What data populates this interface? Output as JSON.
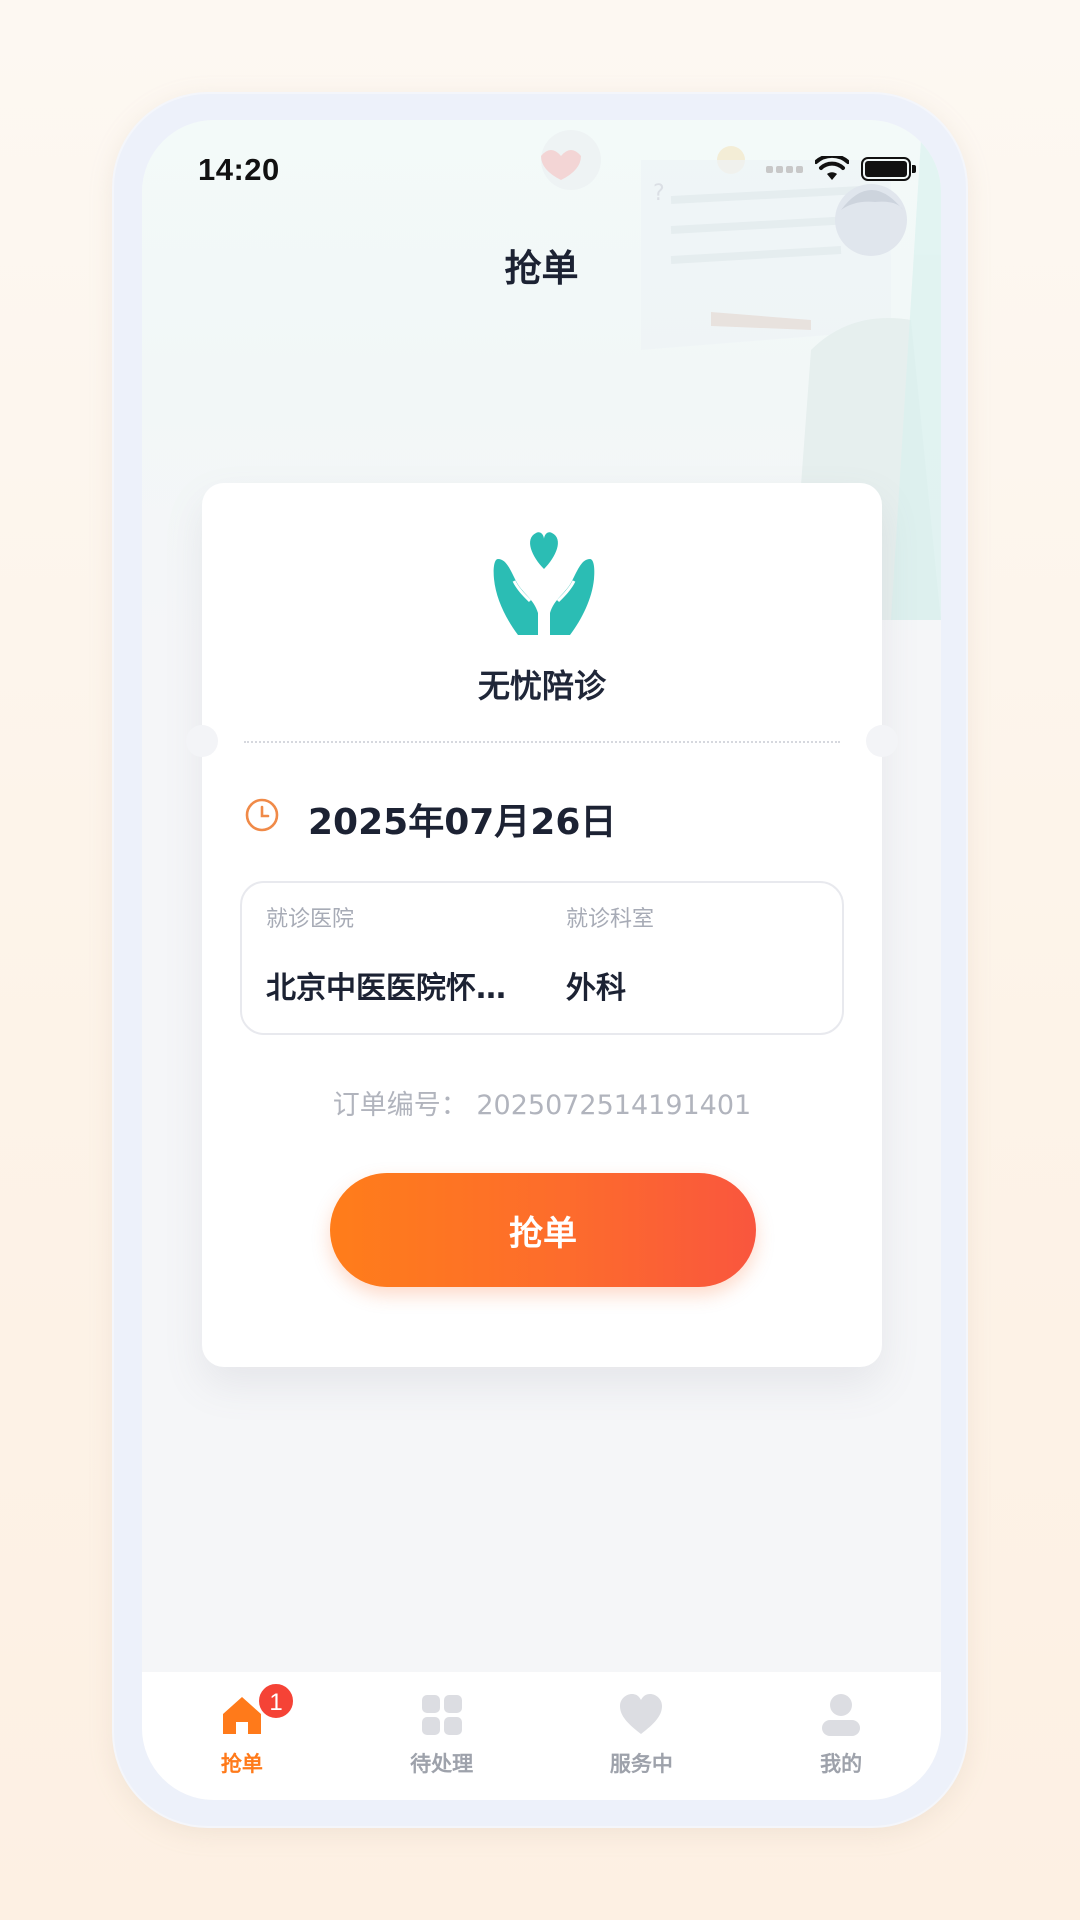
{
  "status_bar": {
    "time": "14:20",
    "icons": [
      "signal-icon",
      "wifi-icon",
      "battery-icon"
    ]
  },
  "header": {
    "title": "抢单"
  },
  "card": {
    "brand_name": "无忧陪诊",
    "logo": "hands-heart-icon",
    "date": "2025年07月26日",
    "hospital_label": "就诊医院",
    "hospital_value": "北京中医医院怀…",
    "department_label": "就诊科室",
    "department_value": "外科",
    "order_no": "订单编号： 2025072514191401",
    "grab_button": "抢单"
  },
  "tab_bar": {
    "items": [
      {
        "label": "抢单",
        "icon": "home-icon",
        "active": true,
        "badge": "1"
      },
      {
        "label": "待处理",
        "icon": "grid-icon",
        "active": false
      },
      {
        "label": "服务中",
        "icon": "heart-icon",
        "active": false
      },
      {
        "label": "我的",
        "icon": "user-icon",
        "active": false
      }
    ]
  },
  "colors": {
    "accent": "#ff7a1a",
    "brand": "#2bbdb4",
    "badge": "#f54336",
    "text": "#1c2233"
  }
}
